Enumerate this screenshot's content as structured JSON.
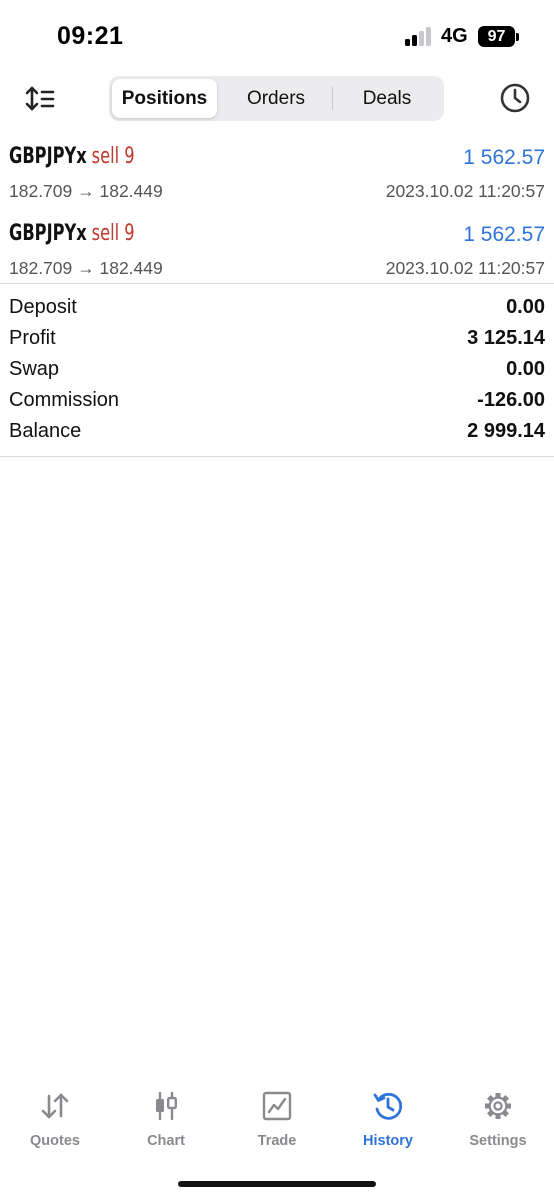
{
  "status_bar": {
    "time": "09:21",
    "network": "4G",
    "battery": "97"
  },
  "toolbar": {
    "tabs": [
      {
        "label": "Positions",
        "active": true
      },
      {
        "label": "Orders",
        "active": false
      },
      {
        "label": "Deals",
        "active": false
      }
    ],
    "left_icon": "sort-icon",
    "right_icon": "clock-icon"
  },
  "positions": [
    {
      "symbol": "GBPJPYx",
      "side": "sell 9",
      "profit": "1 562.57",
      "prices": "182.709 → 182.449",
      "date": "2023.10.02 11:20:57"
    },
    {
      "symbol": "GBPJPYx",
      "side": "sell 9",
      "profit": "1 562.57",
      "prices": "182.709 → 182.449",
      "date": "2023.10.02 11:20:57"
    }
  ],
  "summary": [
    {
      "label": "Deposit",
      "value": "0.00"
    },
    {
      "label": "Profit",
      "value": "3 125.14"
    },
    {
      "label": "Swap",
      "value": "0.00"
    },
    {
      "label": "Commission",
      "value": "-126.00"
    },
    {
      "label": "Balance",
      "value": "2 999.14"
    }
  ],
  "tabbar": [
    {
      "label": "Quotes",
      "icon": "quotes-icon",
      "active": false
    },
    {
      "label": "Chart",
      "icon": "chart-icon",
      "active": false
    },
    {
      "label": "Trade",
      "icon": "trade-icon",
      "active": false
    },
    {
      "label": "History",
      "icon": "history-icon",
      "active": true
    },
    {
      "label": "Settings",
      "icon": "gear-icon",
      "active": false
    }
  ],
  "colors": {
    "accent": "#2f74d8",
    "sell": "#c0392b",
    "muted": "#8a8a8e"
  }
}
